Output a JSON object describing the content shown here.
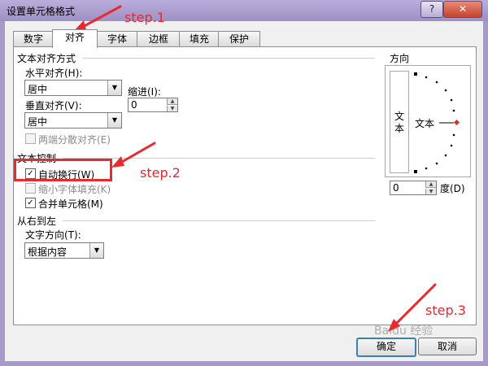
{
  "window": {
    "title": "设置单元格格式",
    "help_label": "?",
    "close_label": "✕"
  },
  "tabs": [
    {
      "label": "数字",
      "active": false
    },
    {
      "label": "对齐",
      "active": true
    },
    {
      "label": "字体",
      "active": false
    },
    {
      "label": "边框",
      "active": false
    },
    {
      "label": "填充",
      "active": false
    },
    {
      "label": "保护",
      "active": false
    }
  ],
  "text_alignment": {
    "group_title": "文本对齐方式",
    "horizontal_label": "水平对齐(H):",
    "horizontal_value": "居中",
    "indent_label": "缩进(I):",
    "indent_value": "0",
    "vertical_label": "垂直对齐(V):",
    "vertical_value": "居中",
    "justify_distributed_label": "两端分散对齐(E)"
  },
  "text_control": {
    "group_title": "文本控制",
    "wrap_text_label": "自动换行(W)",
    "wrap_text_checked": true,
    "shrink_to_fit_label": "缩小字体填充(K)",
    "shrink_to_fit_checked": false,
    "merge_cells_label": "合并单元格(M)",
    "merge_cells_checked": true
  },
  "rtl": {
    "group_title": "从右到左",
    "direction_label": "文字方向(T):",
    "direction_value": "根据内容"
  },
  "orientation": {
    "group_title": "方向",
    "vertical_text": "文本",
    "dial_text": "文本",
    "degrees_value": "0",
    "degrees_label": "度(D)"
  },
  "buttons": {
    "ok_label": "确定",
    "cancel_label": "取消"
  },
  "annotations": {
    "step1": "step.1",
    "step2": "step.2",
    "step3": "step.3",
    "color": "#e8292d"
  },
  "watermark": "Baidu 经验"
}
